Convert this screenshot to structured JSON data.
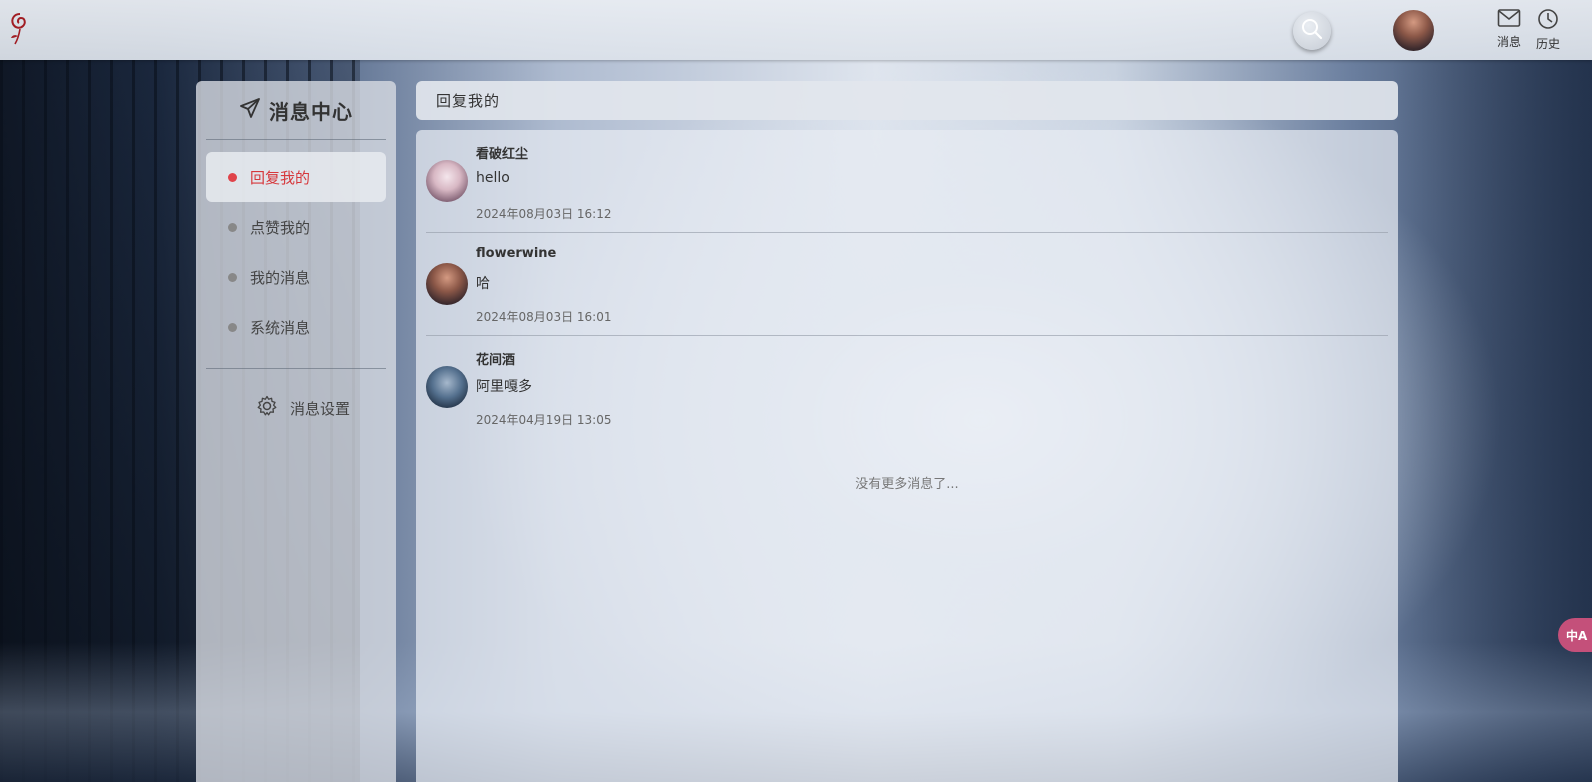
{
  "topbar": {
    "logo_icon": "rose-icon",
    "search_icon": "search-icon",
    "nav": [
      {
        "label": "消息",
        "icon": "mail-icon"
      },
      {
        "label": "历史",
        "icon": "clock-icon"
      }
    ]
  },
  "sidebar": {
    "title": "消息中心",
    "title_icon": "send-icon",
    "items": [
      {
        "label": "回复我的",
        "active": true
      },
      {
        "label": "点赞我的",
        "active": false
      },
      {
        "label": "我的消息",
        "active": false
      },
      {
        "label": "系统消息",
        "active": false
      }
    ],
    "settings_label": "消息设置",
    "settings_icon": "gear-icon"
  },
  "main": {
    "header": "回复我的",
    "messages": [
      {
        "user": "看破红尘",
        "text": "hello",
        "time": "2024年08月03日 16:12"
      },
      {
        "user": "flowerwine",
        "text": "哈",
        "time": "2024年08月03日 16:01"
      },
      {
        "user": "花间酒",
        "text": "阿里嘎多",
        "time": "2024年04月19日 13:05"
      }
    ],
    "no_more": "没有更多消息了..."
  },
  "translate_fab": {
    "label": "中A",
    "icon": "translate-icon"
  },
  "colors": {
    "accent": "#e0434a",
    "active_text": "#d6383c"
  }
}
